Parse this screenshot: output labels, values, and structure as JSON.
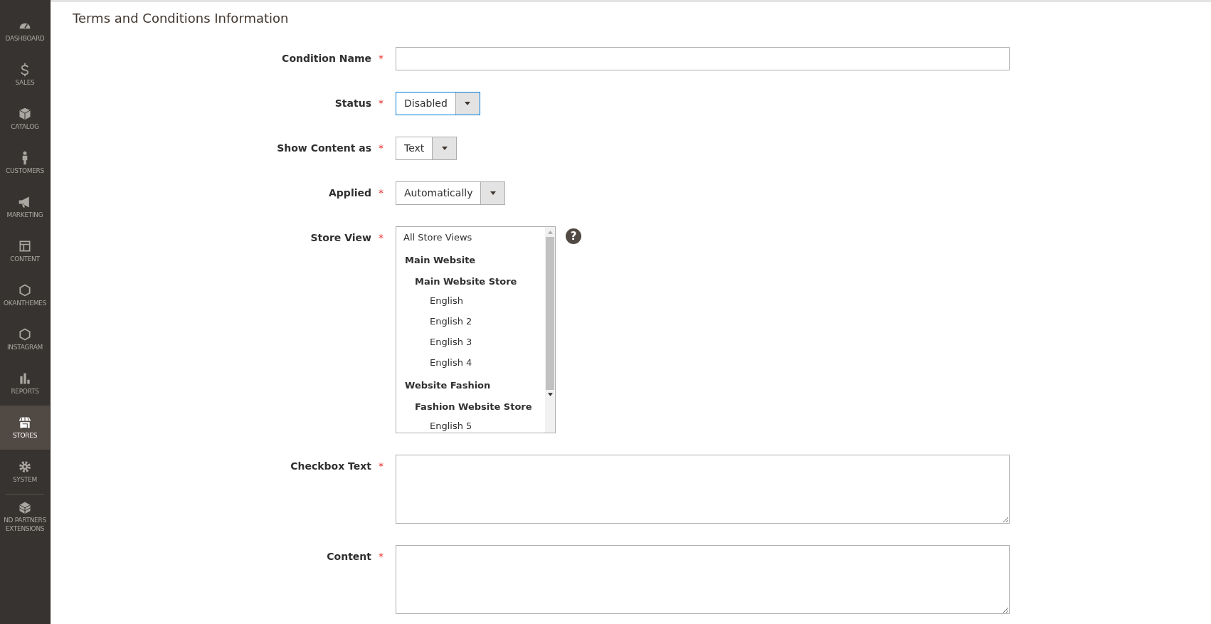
{
  "sidebar": {
    "items": [
      {
        "label": "DASHBOARD",
        "selected": false
      },
      {
        "label": "SALES",
        "selected": false
      },
      {
        "label": "CATALOG",
        "selected": false
      },
      {
        "label": "CUSTOMERS",
        "selected": false
      },
      {
        "label": "MARKETING",
        "selected": false
      },
      {
        "label": "CONTENT",
        "selected": false
      },
      {
        "label": "OKANTHEMES",
        "selected": false
      },
      {
        "label": "INSTAGRAM",
        "selected": false
      },
      {
        "label": "REPORTS",
        "selected": false
      },
      {
        "label": "STORES",
        "selected": true
      },
      {
        "label": "SYSTEM",
        "selected": false
      },
      {
        "label": "ND PARTNERS EXTENSIONS",
        "selected": false
      }
    ]
  },
  "section_title": "Terms and Conditions Information",
  "fields": [
    {
      "label": "Condition Name",
      "required_mark": "*",
      "kind": "text"
    },
    {
      "label": "Status",
      "required_mark": "*",
      "kind": "select",
      "value": "Disabled",
      "focused": true
    },
    {
      "label": "Show Content as",
      "required_mark": "*",
      "kind": "select",
      "value": "Text",
      "focused": false
    },
    {
      "label": "Applied",
      "required_mark": "*",
      "kind": "select",
      "value": "Automatically",
      "focused": false
    },
    {
      "label": "Store View",
      "required_mark": "*",
      "kind": "multiselect",
      "help": "?",
      "options": [
        {
          "label": "All Store Views",
          "selected": false
        },
        {
          "label": "Main Website",
          "children": [
            {
              "label": "Main Website Store",
              "children": [
                {
                  "label": "English",
                  "selected": false
                },
                {
                  "label": "English 2",
                  "selected": false
                },
                {
                  "label": "English 3",
                  "selected": false
                },
                {
                  "label": "English 4",
                  "selected": false
                }
              ]
            }
          ]
        },
        {
          "label": "Website Fashion",
          "children": [
            {
              "label": "Fashion Website Store",
              "children": [
                {
                  "label": "English 5",
                  "selected": false
                }
              ]
            }
          ]
        }
      ]
    },
    {
      "label": "Checkbox Text",
      "required_mark": "*",
      "kind": "textarea"
    },
    {
      "label": "Content",
      "required_mark": "*",
      "kind": "textarea"
    }
  ]
}
